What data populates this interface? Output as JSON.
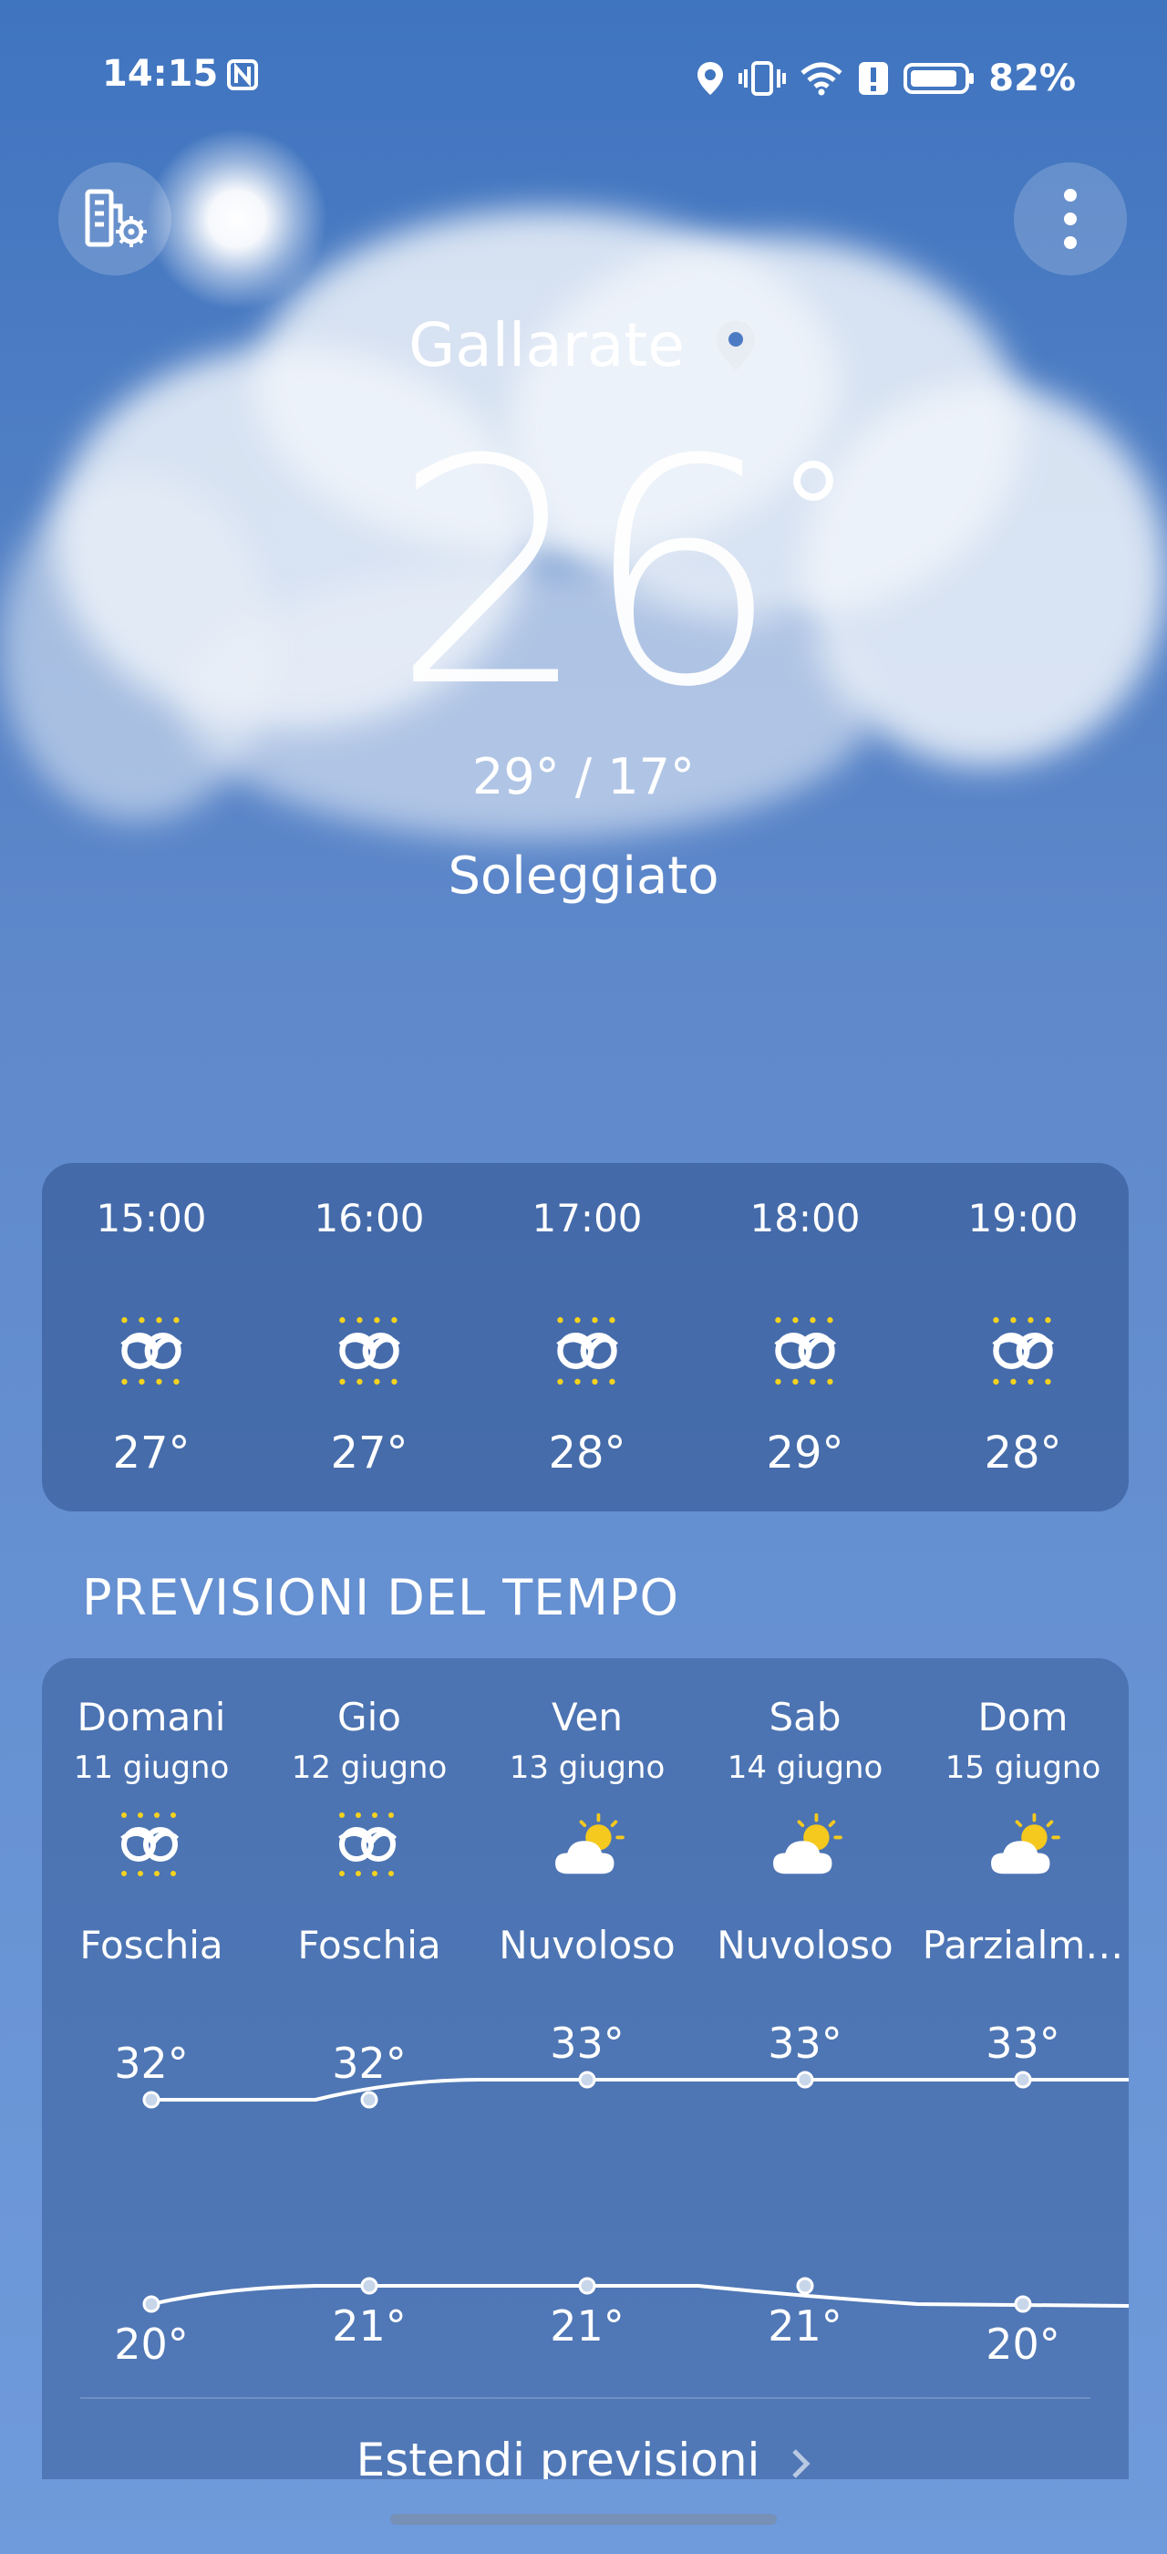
{
  "status_bar": {
    "time": "14:15",
    "battery_percent": "82%",
    "icons": [
      "nfc-icon",
      "location-icon",
      "vibrate-icon",
      "wifi-icon",
      "alert-icon",
      "battery-icon"
    ]
  },
  "toolbar": {
    "left_icon": "city-settings-icon",
    "right_icon": "more-vertical-icon"
  },
  "current": {
    "city": "Gallarate",
    "temperature": "26",
    "minmax": "29° / 17°",
    "condition": "Soleggiato"
  },
  "hourly": [
    {
      "time": "15:00",
      "temp": "27°",
      "icon": "haze-icon"
    },
    {
      "time": "16:00",
      "temp": "27°",
      "icon": "haze-icon"
    },
    {
      "time": "17:00",
      "temp": "28°",
      "icon": "haze-icon"
    },
    {
      "time": "18:00",
      "temp": "29°",
      "icon": "haze-icon"
    },
    {
      "time": "19:00",
      "temp": "28°",
      "icon": "haze-icon"
    }
  ],
  "forecast": {
    "title": "PREVISIONI DEL TEMPO",
    "days": [
      {
        "name": "Domani",
        "date": "11 giugno",
        "icon": "haze-icon",
        "condition": "Foschia",
        "high": "32°",
        "low": "20°"
      },
      {
        "name": "Gio",
        "date": "12 giugno",
        "icon": "haze-icon",
        "condition": "Foschia",
        "high": "32°",
        "low": "21°"
      },
      {
        "name": "Ven",
        "date": "13 giugno",
        "icon": "partly-cloudy-icon",
        "condition": "Nuvoloso",
        "high": "33°",
        "low": "21°"
      },
      {
        "name": "Sab",
        "date": "14 giugno",
        "icon": "partly-cloudy-icon",
        "condition": "Nuvoloso",
        "high": "33°",
        "low": "21°"
      },
      {
        "name": "Dom",
        "date": "15 giugno",
        "icon": "partly-cloudy-icon",
        "condition": "Parzialm…",
        "high": "33°",
        "low": "20°"
      }
    ],
    "expand_label": "Estendi previsioni"
  },
  "colors": {
    "sun_yellow": "#f5d21e",
    "card_bg": "#2d508c"
  }
}
